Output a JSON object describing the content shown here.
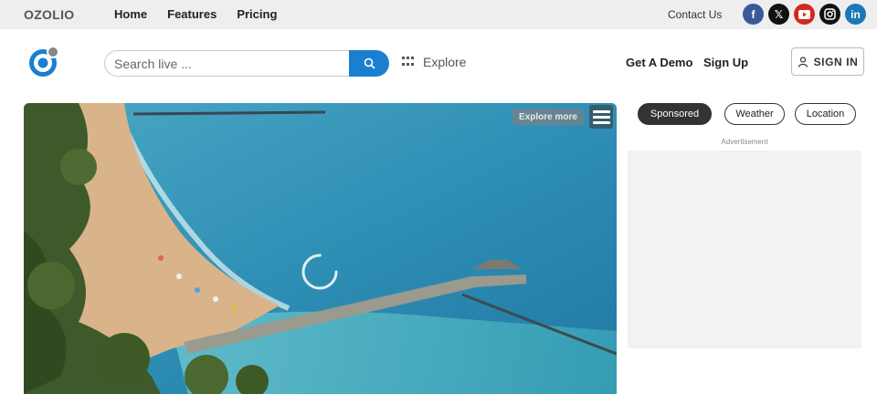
{
  "topbar": {
    "brand": "OZOLIO",
    "nav": [
      "Home",
      "Features",
      "Pricing"
    ],
    "contact": "Contact Us",
    "socials": [
      {
        "name": "facebook",
        "glyph": "f"
      },
      {
        "name": "x",
        "glyph": "𝕏"
      },
      {
        "name": "youtube",
        "glyph": "▶"
      },
      {
        "name": "instagram",
        "glyph": "◎"
      },
      {
        "name": "linkedin",
        "glyph": "in"
      }
    ]
  },
  "header": {
    "search_placeholder": "Search live ...",
    "explore_label": "Explore",
    "get_demo": "Get A Demo",
    "sign_up": "Sign Up",
    "sign_in": "SIGN IN"
  },
  "video": {
    "explore_more": "Explore more"
  },
  "sidebar": {
    "pills": [
      "Sponsored",
      "Weather",
      "Location"
    ],
    "active_pill": "Sponsored",
    "ad_label": "Advertisement"
  },
  "colors": {
    "accent": "#1b7fd1",
    "topbar_bg": "#eeeeee",
    "ad_bg": "#f2f2f2"
  }
}
